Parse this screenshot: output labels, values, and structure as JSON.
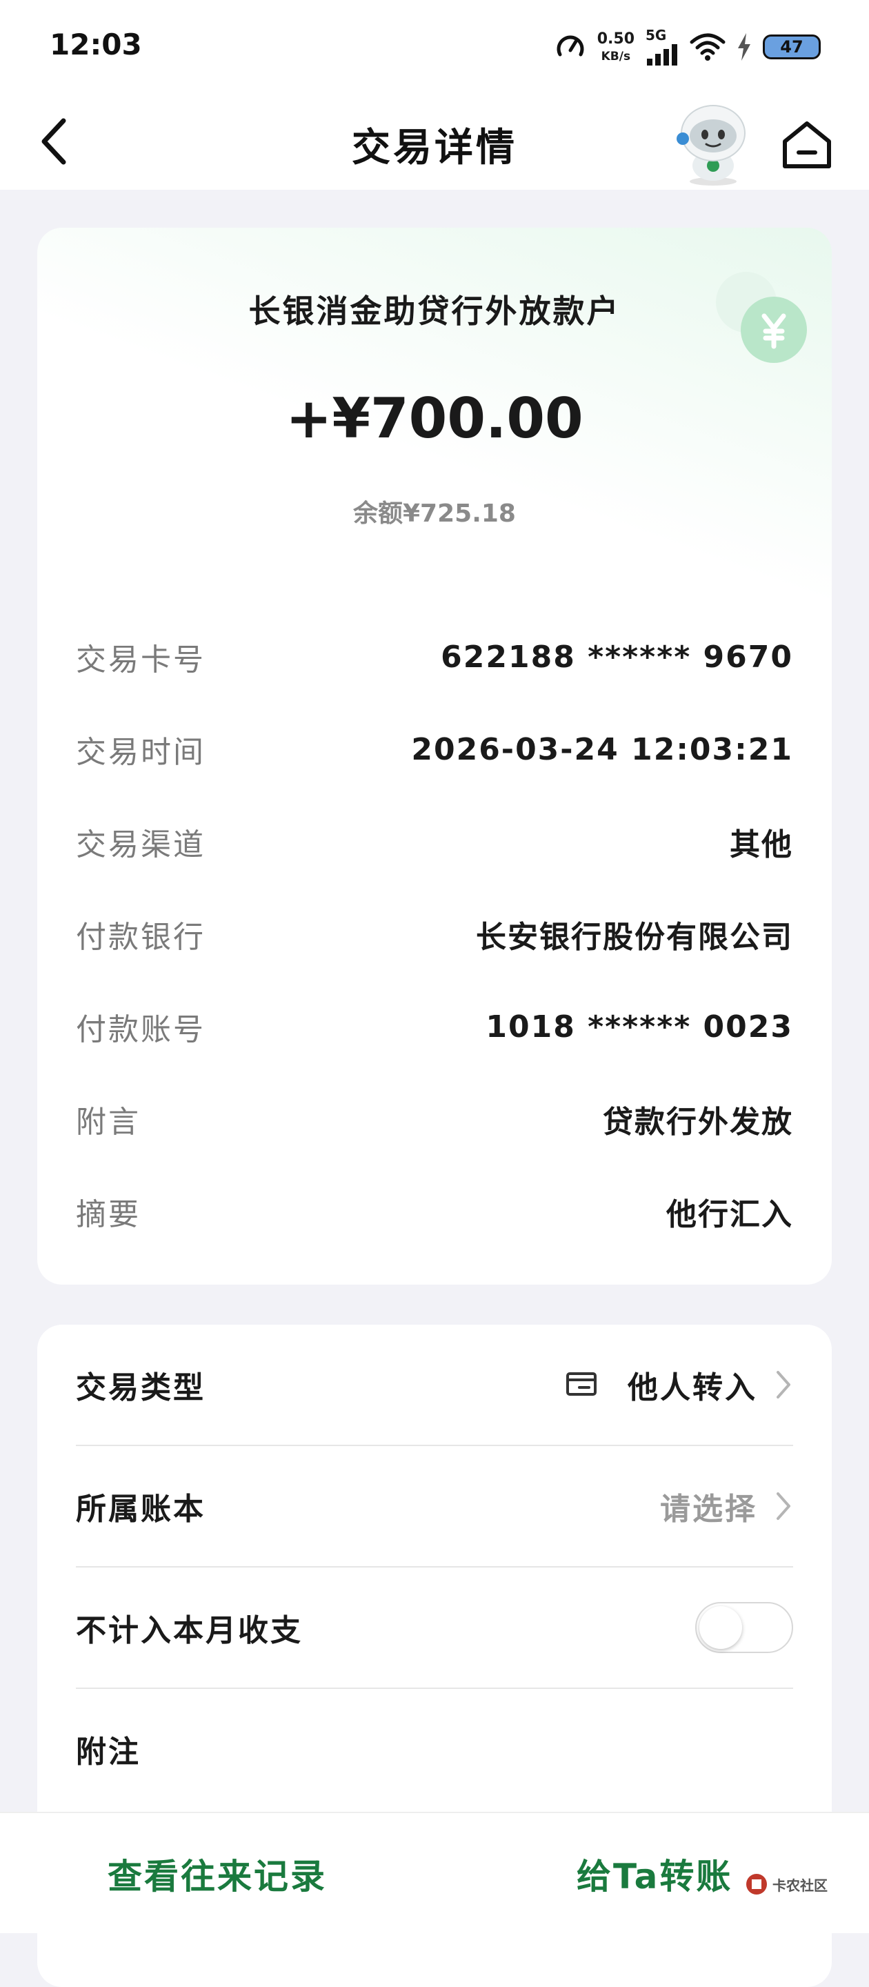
{
  "status_bar": {
    "time": "12:03",
    "speed_value": "0.50",
    "speed_unit": "KB/s",
    "network": "5G",
    "battery": "47",
    "icons": [
      "speedometer-icon",
      "signal-icon",
      "wifi-icon",
      "charging-icon",
      "battery-icon"
    ]
  },
  "nav": {
    "title": "交易详情",
    "back_icon": "chevron-left-icon",
    "assistant_icon": "robot-assistant-icon",
    "home_icon": "home-icon"
  },
  "transaction": {
    "payer_name": "长银消金助贷行外放款户",
    "amount": "+¥700.00",
    "balance": "余额¥725.18",
    "details": [
      {
        "label": "交易卡号",
        "value": "622188 ****** 9670"
      },
      {
        "label": "交易时间",
        "value": "2026-03-24 12:03:21"
      },
      {
        "label": "交易渠道",
        "value": "其他"
      },
      {
        "label": "付款银行",
        "value": "长安银行股份有限公司"
      },
      {
        "label": "付款账号",
        "value": "1018 ****** 0023"
      },
      {
        "label": "附言",
        "value": "贷款行外发放"
      },
      {
        "label": "摘要",
        "value": "他行汇入"
      }
    ]
  },
  "settings": {
    "type_label": "交易类型",
    "type_value": "他人转入",
    "book_label": "所属账本",
    "book_value": "请选择",
    "exclude_label": "不计入本月收支",
    "exclude_enabled": false,
    "note_label": "附注"
  },
  "bottom": {
    "history_label": "查看往来记录",
    "transfer_label": "给Ta转账",
    "watermark_text": "卡农社区"
  },
  "colors": {
    "accent_green": "#1a7a3e",
    "coin_green": "#b9e6c9",
    "label_gray": "#7a7a7a"
  }
}
